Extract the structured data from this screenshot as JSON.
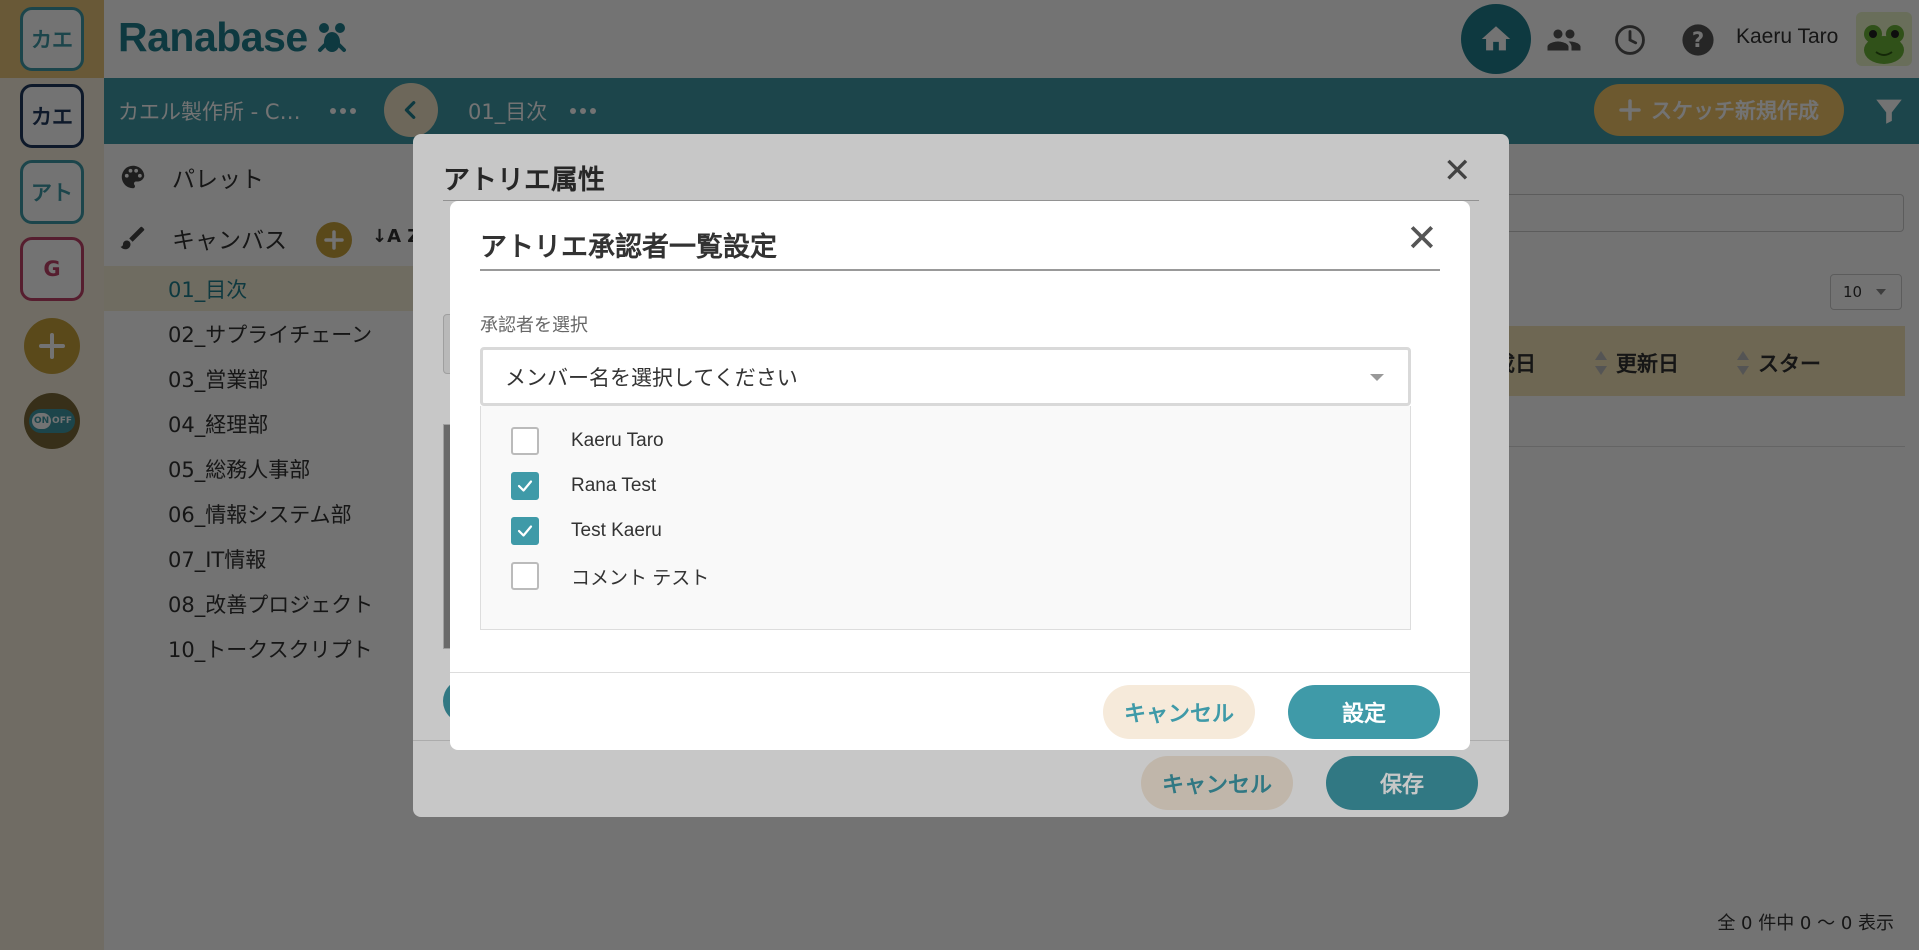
{
  "app": {
    "logo": "Ranabase",
    "user_name": "Kaeru Taro"
  },
  "rail": {
    "workspace_top": "カエ",
    "items": [
      "カエ",
      "アト",
      "G"
    ],
    "toggle_on": "ON",
    "toggle_off": "OFF"
  },
  "subbar": {
    "org_name": "カエル製作所 - C…",
    "canvas_name": "01_目次",
    "new_sketch_label": "スケッチ新規作成"
  },
  "sidebar": {
    "palette_label": "パレット",
    "canvas_label": "キャンバス",
    "sort_label": "↓A Z",
    "items": [
      "01_目次",
      "02_サプライチェーン",
      "03_営業部",
      "04_経理部",
      "05_総務人事部",
      "06_情報システム部",
      "07_IT情報",
      "08_改善プロジェクト",
      "10_トークスクリプト"
    ],
    "active_index": 0
  },
  "main": {
    "page_size": "10",
    "columns": [
      "成日",
      "更新日",
      "スター"
    ],
    "footer_count": "全 0 件中 0 〜 0 表示"
  },
  "atelier_modal": {
    "title": "アトリエ属性",
    "cancel_label": "キャンセル",
    "save_label": "保存"
  },
  "approver_modal": {
    "title": "アトリエ承認者一覧設定",
    "select_label": "承認者を選択",
    "select_placeholder": "メンバー名を選択してください",
    "options": [
      {
        "name": "Kaeru Taro",
        "checked": false
      },
      {
        "name": "Rana Test",
        "checked": true
      },
      {
        "name": "Test Kaeru",
        "checked": true
      },
      {
        "name": "コメント テスト",
        "checked": false
      }
    ],
    "cancel_label": "キャンセル",
    "submit_label": "設定"
  },
  "colors": {
    "primary": "#3f9aa8",
    "brand": "#1f7f8f",
    "accent": "#f2c46a"
  }
}
